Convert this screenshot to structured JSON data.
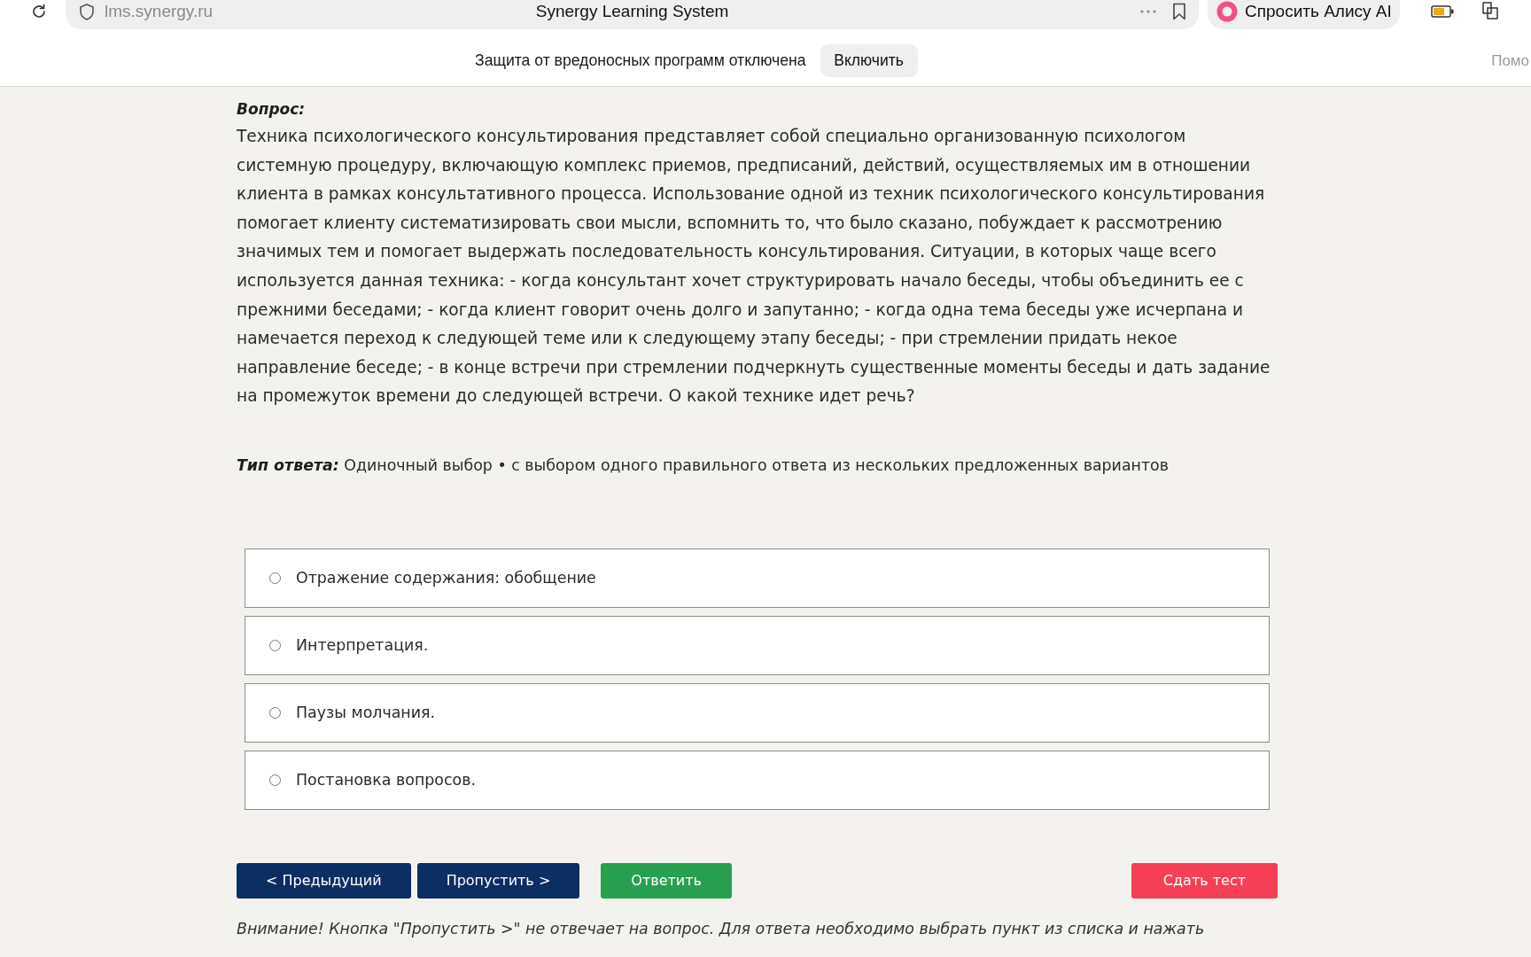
{
  "browser": {
    "address": "lms.synergy.ru",
    "page_title": "Synergy Learning System",
    "assistant_button": "Спросить Алису AI"
  },
  "infobar": {
    "message": "Защита от вредоносных программ отключена",
    "button": "Включить",
    "side_link": "Помо"
  },
  "question": {
    "label": "Вопрос:",
    "text": "Техника психологического консультирования представляет собой специально организованную психологом системную процедуру, включающую комплекс приемов, предписаний, действий, осуществляемых им в отношении клиента в рамках консультативного процесса. Использование одной из техник психологического консультирования помогает клиенту систематизировать свои мысли, вспомнить то, что было сказано, побуждает к рассмотрению значимых тем и помогает выдержать последовательность консультирования. Ситуации, в которых чаще всего используется данная техника: - когда консультант хочет структурировать начало беседы, чтобы объединить ее с прежними беседами; - когда клиент говорит очень долго и запутанно; - когда одна тема беседы уже исчерпана и намечается переход к следующей теме или к следующему этапу беседы; - при стремлении придать некое направление беседе; - в конце встречи при стремлении подчеркнуть существенные моменты беседы и дать задание на промежуток времени до следующей встречи. О какой технике идет речь?"
  },
  "answer_type": {
    "label": "Тип ответа:",
    "value": "Одиночный выбор • с выбором одного правильного ответа из нескольких предложенных вариантов"
  },
  "options": [
    {
      "label": "Отражение содержания: обобщение",
      "selected": false
    },
    {
      "label": "Интерпретация.",
      "selected": false
    },
    {
      "label": "Паузы молчания.",
      "selected": false
    },
    {
      "label": "Постановка вопросов.",
      "selected": false
    }
  ],
  "buttons": [
    {
      "label": "< Предыдущий",
      "kind": "nav"
    },
    {
      "label": "Пропустить >",
      "kind": "nav"
    },
    {
      "label": "Ответить",
      "kind": "answer"
    },
    {
      "label": "Сдать тест",
      "kind": "finish"
    }
  ],
  "notice": "Внимание! Кнопка \"Пропустить >\" не отвечает на вопрос. Для ответа необходимо выбрать пункт из списка и нажать"
}
